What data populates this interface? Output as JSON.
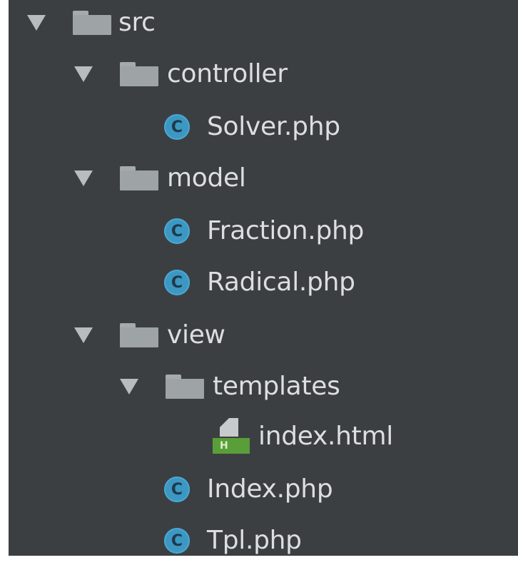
{
  "tree": {
    "src": {
      "label": "src",
      "icon": "folder-icon",
      "expanded": true
    },
    "controller": {
      "label": "controller",
      "icon": "folder-icon",
      "expanded": true
    },
    "solver": {
      "label": "Solver.php",
      "icon": "php-class-icon",
      "badge": "C"
    },
    "model": {
      "label": "model",
      "icon": "folder-icon",
      "expanded": true
    },
    "fraction": {
      "label": "Fraction.php",
      "icon": "php-class-icon",
      "badge": "C"
    },
    "radical": {
      "label": "Radical.php",
      "icon": "php-class-icon",
      "badge": "C"
    },
    "view": {
      "label": "view",
      "icon": "folder-icon",
      "expanded": true
    },
    "templates": {
      "label": "templates",
      "icon": "folder-icon",
      "expanded": true
    },
    "index_html": {
      "label": "index.html",
      "icon": "html-file-icon",
      "badge": "H"
    },
    "index_php": {
      "label": "Index.php",
      "icon": "php-class-icon",
      "badge": "C"
    },
    "tpl": {
      "label": "Tpl.php",
      "icon": "php-class-icon",
      "badge": "C"
    }
  },
  "colors": {
    "panel_background": "#3c3f41",
    "text": "#dcdedf",
    "folder": "#9ea3a6",
    "class_icon": "#3d97c3",
    "html_icon": "#5a9e3a"
  }
}
